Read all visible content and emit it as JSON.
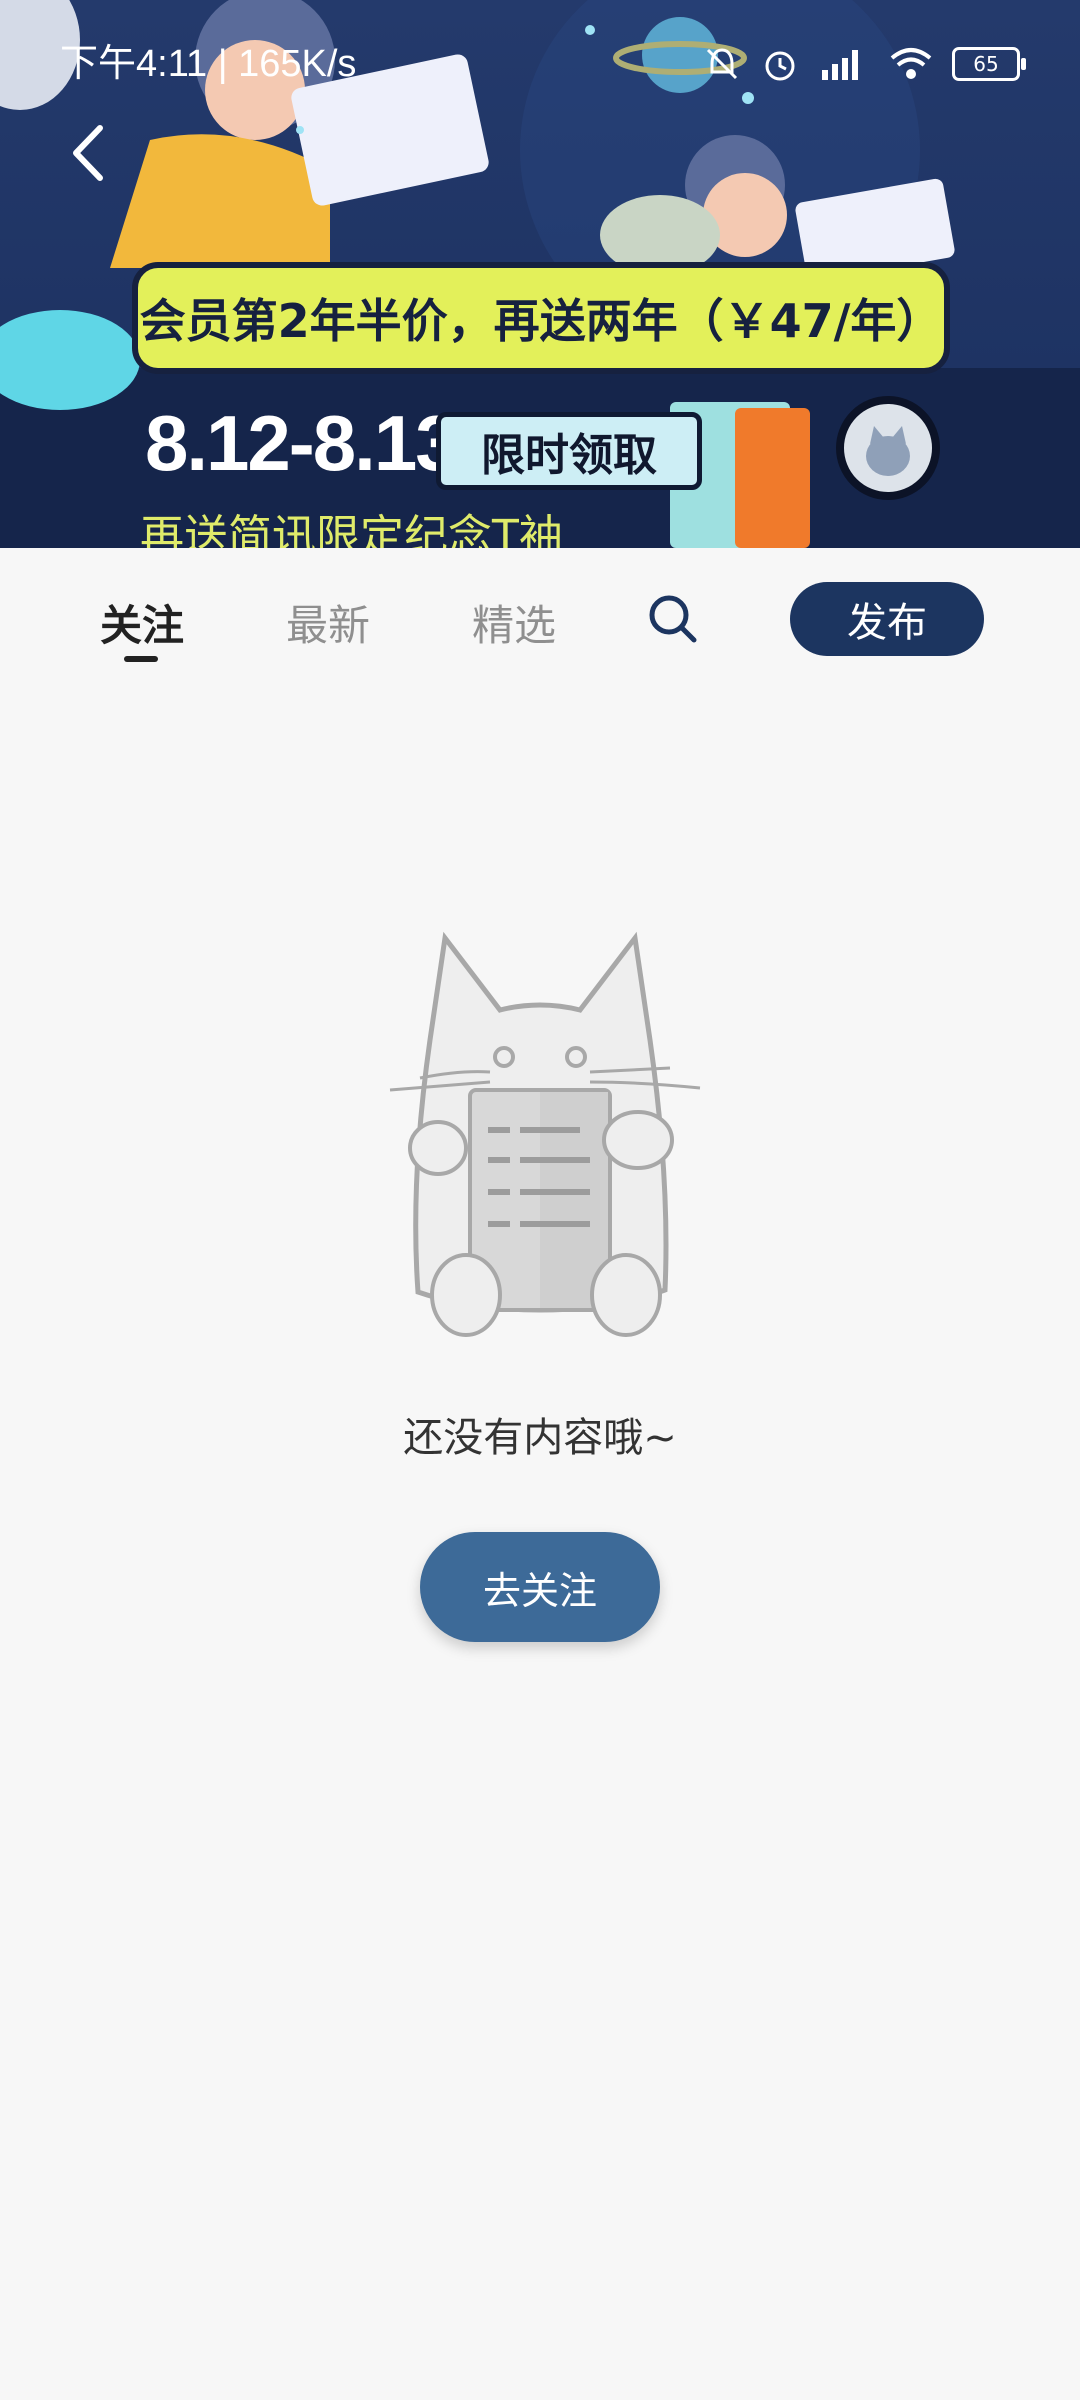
{
  "status_bar": {
    "time_speed": "下午4:11 | 165K/s",
    "battery": "65"
  },
  "banner": {
    "promo_text": "会员第2年半价，再送两年（￥47/年）",
    "date_range": "8.12-8.13",
    "limited_badge": "限时领取",
    "gift_text": "再送简讯限定纪念T袖"
  },
  "tabs": [
    {
      "label": "关注",
      "active": true
    },
    {
      "label": "最新",
      "active": false
    },
    {
      "label": "精选",
      "active": false
    }
  ],
  "publish_label": "发布",
  "empty_state": {
    "message": "还没有内容哦~",
    "button_label": "去关注"
  },
  "icons": {
    "back": "back-arrow-icon",
    "search": "search-icon",
    "mute": "bell-off-icon",
    "alarm": "alarm-icon",
    "signal": "signal-icon",
    "wifi": "wifi-icon"
  },
  "colors": {
    "primary": "#1c3560",
    "accent_button": "#3d6a98",
    "promo_yellow": "#e3f05a",
    "background": "#f7f7f7"
  }
}
